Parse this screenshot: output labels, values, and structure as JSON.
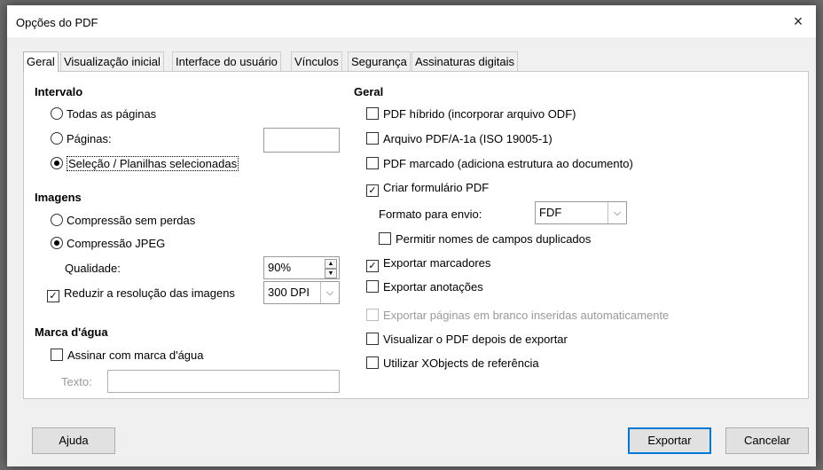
{
  "window": {
    "title": "Opções do PDF",
    "close": "×"
  },
  "tabs": [
    "Geral",
    "Visualização inicial",
    "Interface do usuário",
    "Vínculos",
    "Segurança",
    "Assinaturas digitais"
  ],
  "left": {
    "intervalo": {
      "heading": "Intervalo",
      "todas": "Todas as páginas",
      "paginas": "Páginas:",
      "paginas_value": "",
      "selecao": "Seleção / Planilhas selecionadas"
    },
    "imagens": {
      "heading": "Imagens",
      "sem_perdas": "Compressão sem perdas",
      "jpeg": "Compressão JPEG",
      "qualidade_label": "Qualidade:",
      "qualidade_value": "90%",
      "reduzir": "Reduzir a resolução das imagens",
      "dpi_value": "300 DPI"
    },
    "marca": {
      "heading": "Marca d'água",
      "assinar": "Assinar com marca d'água",
      "texto_label": "Texto:",
      "texto_value": ""
    }
  },
  "right": {
    "heading": "Geral",
    "hibrido": "PDF híbrido (incorporar arquivo ODF)",
    "pdfa": "Arquivo PDF/A-1a (ISO 19005-1)",
    "marcado": "PDF marcado (adiciona estrutura ao documento)",
    "formulario": "Criar formulário PDF",
    "formato_label": "Formato para envio:",
    "formato_value": "FDF",
    "permitir": "Permitir nomes de campos duplicados",
    "marcadores": "Exportar marcadores",
    "anotacoes": "Exportar anotações",
    "em_branco": "Exportar páginas em branco inseridas automaticamente",
    "visualizar": "Visualizar o PDF depois de exportar",
    "xobjects": "Utilizar XObjects de referência"
  },
  "state": {
    "intervalo": "selecao",
    "imagens": "jpeg",
    "hibrido": false,
    "pdfa": false,
    "marcado": false,
    "formulario": true,
    "permitir": false,
    "marcadores": true,
    "anotacoes": false,
    "em_branco": false,
    "visualizar": false,
    "xobjects": false,
    "reduzir": true,
    "assinar": false
  },
  "icons": {
    "check": "✓",
    "spin_up": "▲",
    "spin_down": "▼",
    "dropdown": "⌵"
  },
  "buttons": {
    "ajuda": "Ajuda",
    "exportar": "Exportar",
    "cancelar": "Cancelar"
  },
  "colors": {
    "accent": "#0078d7",
    "disabled_text": "#9a9a9a"
  }
}
